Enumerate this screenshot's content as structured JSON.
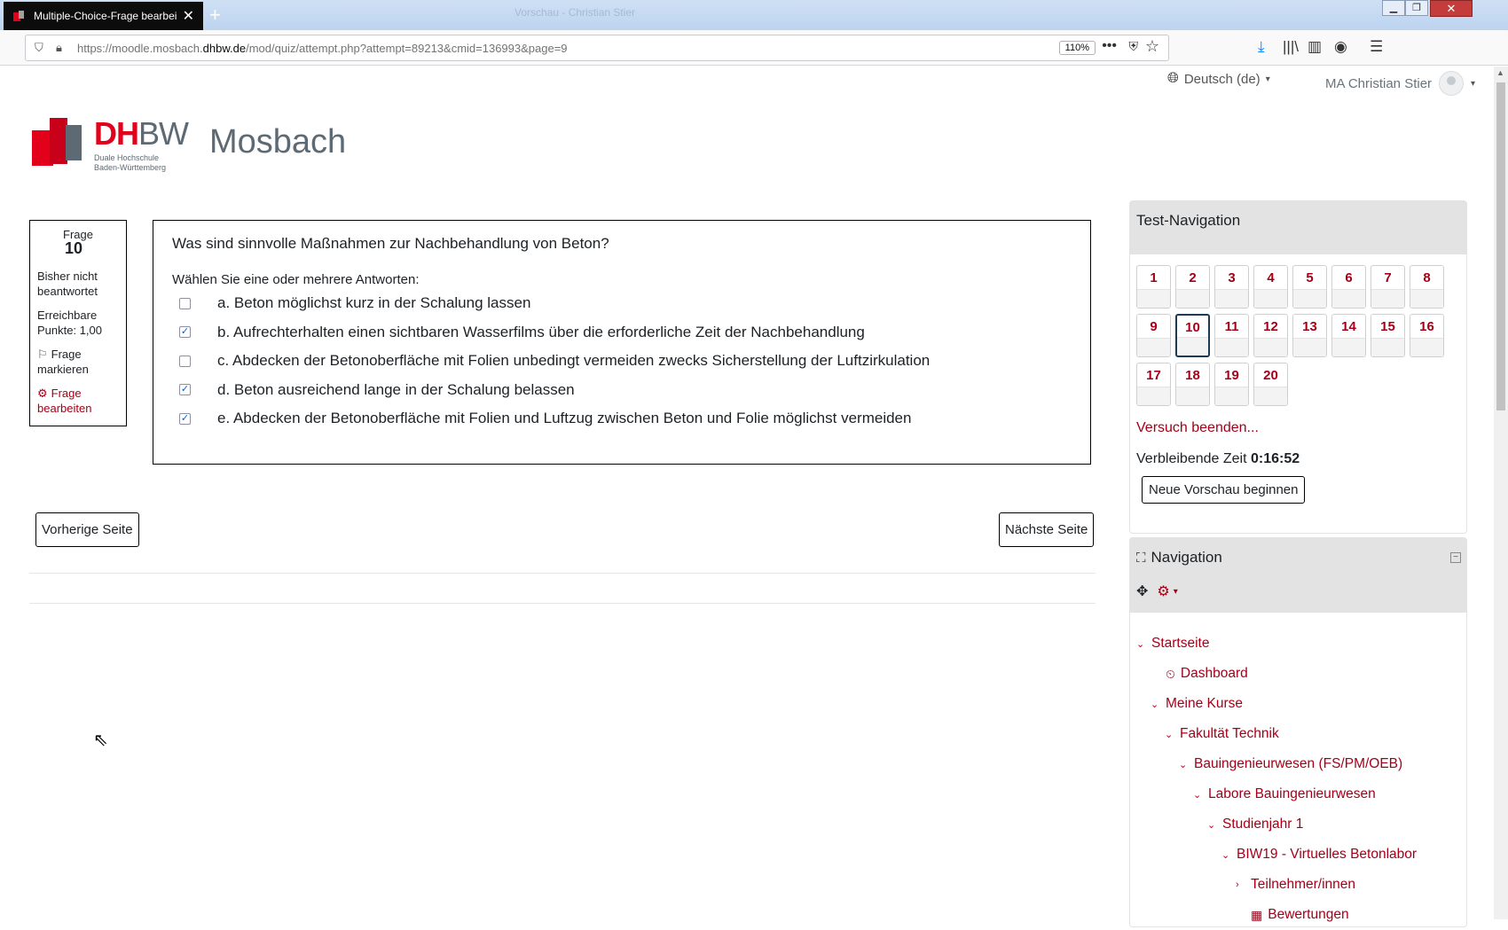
{
  "browser": {
    "tab_title": "Multiple-Choice-Frage bearbei",
    "window_title": "Vorschau - Christian Stier",
    "url_prefix": "https://moodle.mosbach.",
    "url_domain": "dhbw.de",
    "url_path": "/mod/quiz/attempt.php?attempt=89213&cmid=136993&page=9",
    "zoom": "110%"
  },
  "header": {
    "language": "Deutsch (de)",
    "user_name": "MA Christian Stier"
  },
  "logo": {
    "dh": "DH",
    "bw": "BW",
    "sub1": "Duale Hochschule",
    "sub2": "Baden-Württemberg",
    "campus": "Mosbach"
  },
  "question_info": {
    "label": "Frage",
    "number": "10",
    "state": "Bisher nicht beantwortet",
    "grade": "Erreichbare Punkte: 1,00",
    "flag": "Frage markieren",
    "edit": "Frage bearbeiten"
  },
  "question": {
    "text": "Was sind sinnvolle Maßnahmen zur Nachbehandlung von Beton?",
    "prompt": "Wählen Sie eine oder mehrere Antworten:",
    "answers": [
      {
        "label": "a. Beton möglichst kurz in der Schalung lassen",
        "checked": false
      },
      {
        "label": "b. Aufrechterhalten einen sichtbaren Wasserfilms über die erforderliche Zeit der Nachbehandlung",
        "checked": true
      },
      {
        "label": "c. Abdecken der Betonoberfläche mit Folien unbedingt vermeiden zwecks Sicherstellung der Luftzirkulation",
        "checked": false
      },
      {
        "label": "d. Beton ausreichend lange in der Schalung belassen",
        "checked": true
      },
      {
        "label": "e. Abdecken der Betonoberfläche mit Folien und Luftzug zwischen Beton und Folie möglichst vermeiden",
        "checked": true
      }
    ]
  },
  "buttons": {
    "prev": "Vorherige Seite",
    "next": "Nächste Seite"
  },
  "quiz_nav": {
    "title": "Test-Navigation",
    "questions": [
      "1",
      "2",
      "3",
      "4",
      "5",
      "6",
      "7",
      "8",
      "9",
      "10",
      "11",
      "12",
      "13",
      "14",
      "15",
      "16",
      "17",
      "18",
      "19",
      "20"
    ],
    "current": "10",
    "finish": "Versuch beenden...",
    "time_label": "Verbleibende Zeit",
    "time_value": "0:16:52",
    "new_preview": "Neue Vorschau beginnen"
  },
  "navigation": {
    "title": "Navigation",
    "items": [
      {
        "label": "Startseite",
        "level": 0,
        "chevron": "⌄",
        "icon": ""
      },
      {
        "label": "Dashboard",
        "level": 1,
        "chevron": "",
        "icon": "dashboard-icon"
      },
      {
        "label": "Meine Kurse",
        "level": 1,
        "chevron": "⌄",
        "icon": ""
      },
      {
        "label": "Fakultät Technik",
        "level": 2,
        "chevron": "⌄",
        "icon": ""
      },
      {
        "label": "Bauingenieurwesen (FS/PM/OEB)",
        "level": 3,
        "chevron": "⌄",
        "icon": ""
      },
      {
        "label": "Labore Bauingenieurwesen",
        "level": 4,
        "chevron": "⌄",
        "icon": ""
      },
      {
        "label": "Studienjahr 1",
        "level": 5,
        "chevron": "⌄",
        "icon": ""
      },
      {
        "label": "BIW19 - Virtuelles Betonlabor",
        "level": 6,
        "chevron": "⌄",
        "icon": ""
      },
      {
        "label": "Teilnehmer/innen",
        "level": 7,
        "chevron": "›",
        "icon": ""
      },
      {
        "label": "Bewertungen",
        "level": 7,
        "chevron": "",
        "icon": "table-icon"
      }
    ]
  },
  "colors": {
    "accent": "#a40018",
    "brand_red": "#e2001a",
    "brand_grey": "#5d6a73"
  }
}
